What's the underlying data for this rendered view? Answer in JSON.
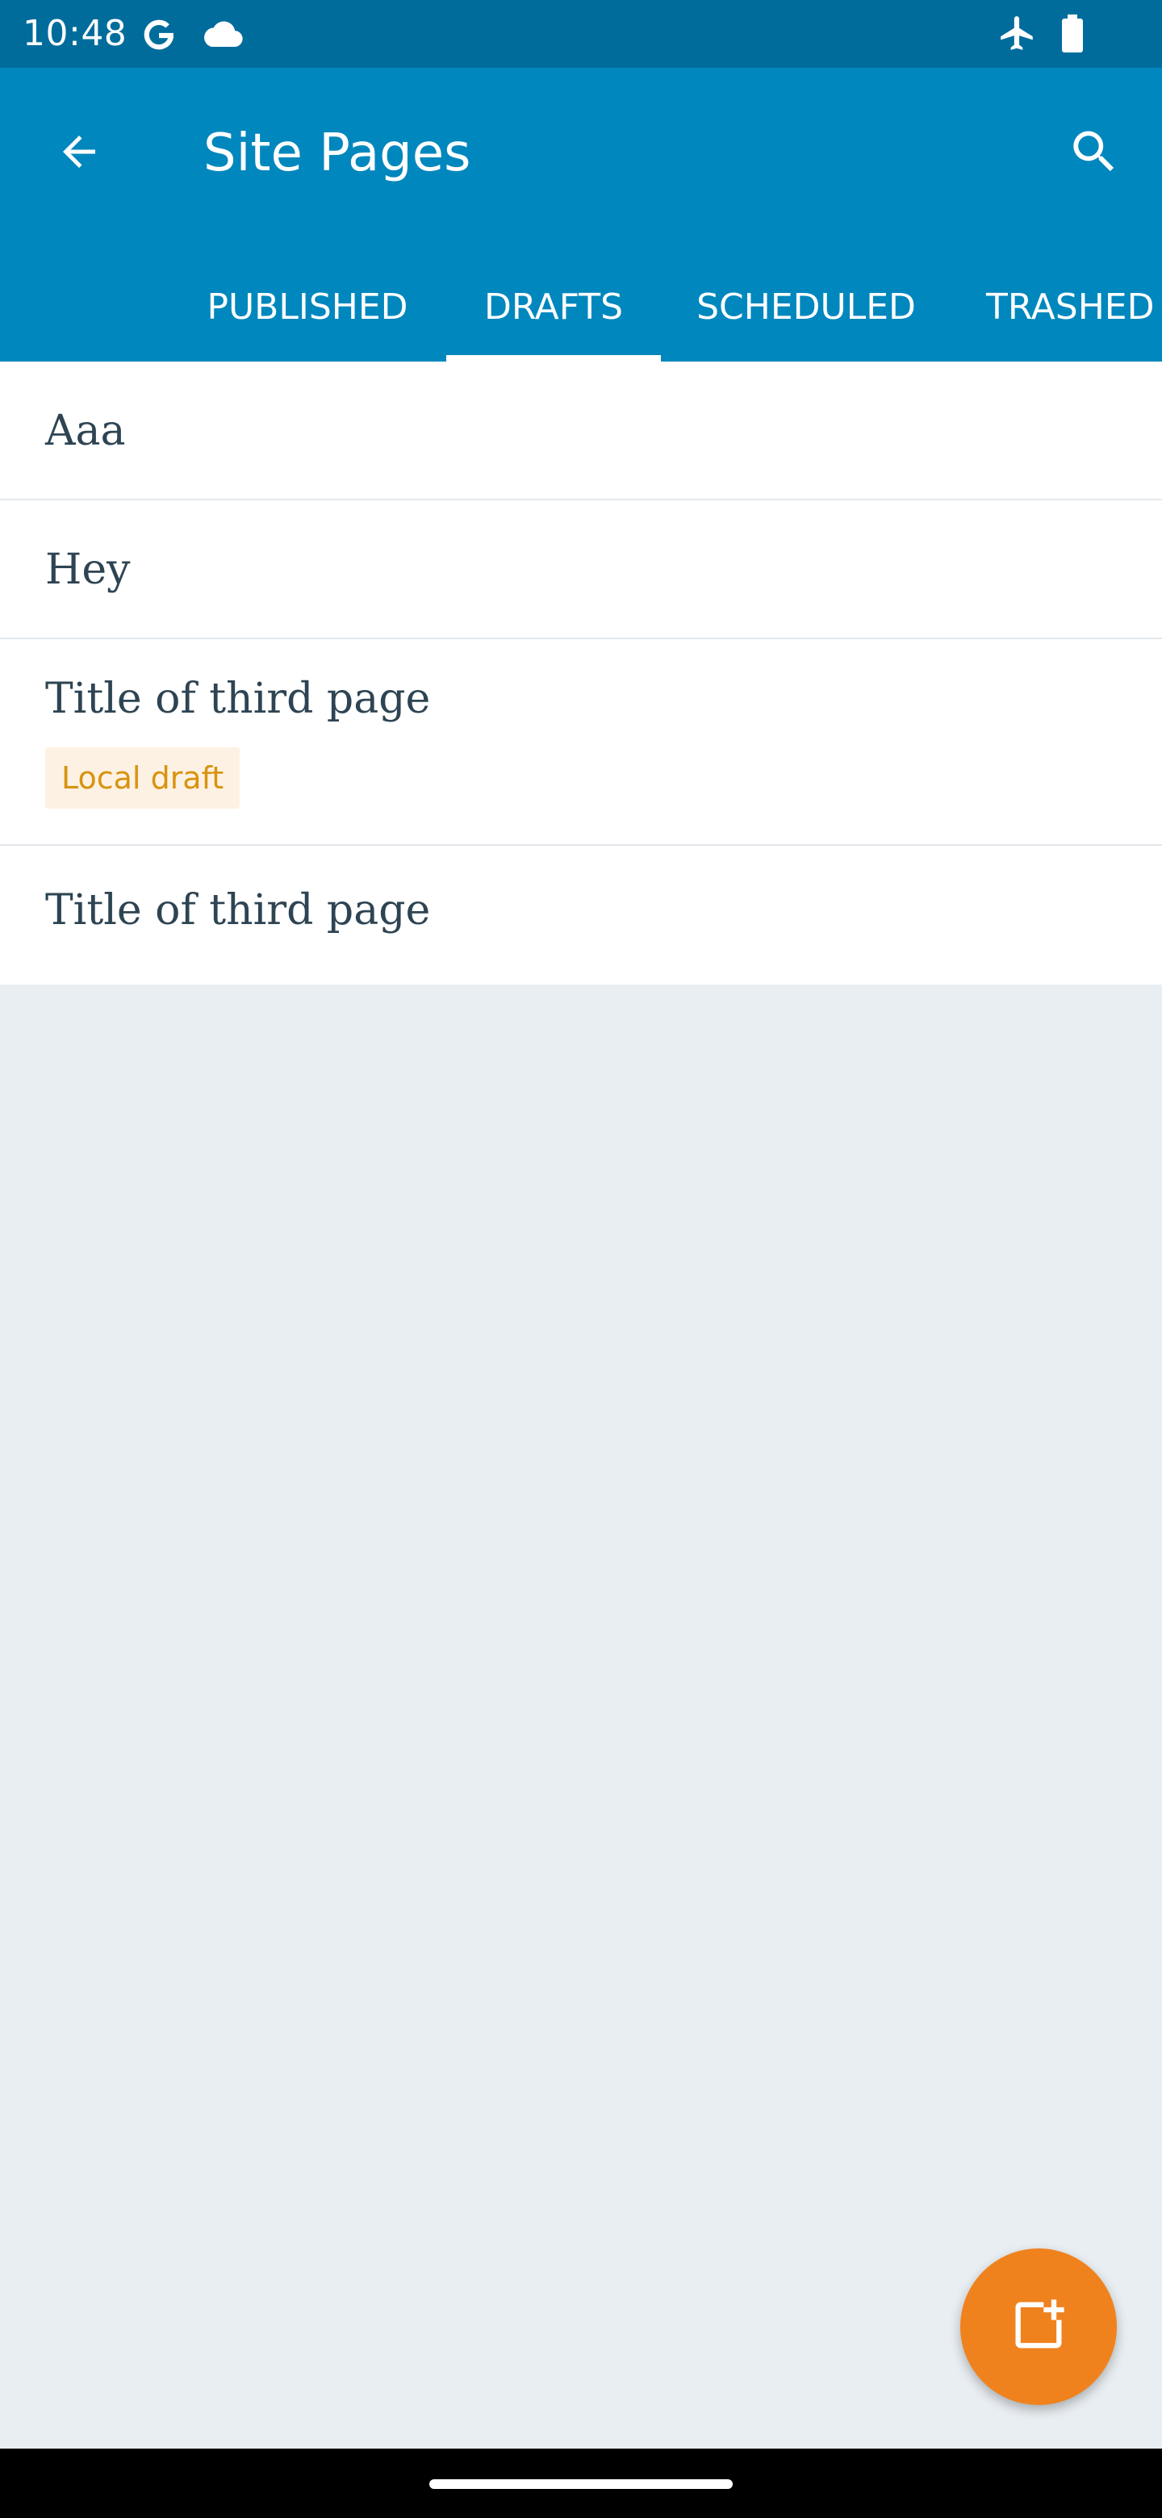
{
  "status_bar": {
    "time": "10:48",
    "left_icons": [
      "google-icon",
      "cloud-icon"
    ],
    "right_icons": [
      "airplane-mode-icon",
      "battery-icon"
    ]
  },
  "app_bar": {
    "title": "Site Pages",
    "back_icon": "arrow-back-icon",
    "search_icon": "search-icon",
    "background_color": "#0087be"
  },
  "tabs": [
    {
      "label": "PUBLISHED",
      "selected": false
    },
    {
      "label": "DRAFTS",
      "selected": true
    },
    {
      "label": "SCHEDULED",
      "selected": false
    },
    {
      "label": "TRASHED",
      "selected": false
    }
  ],
  "pages": [
    {
      "title": "Aaa"
    },
    {
      "title": "Hey"
    },
    {
      "title": "Title of third page",
      "badge": "Local draft"
    },
    {
      "title": "Title of third page"
    }
  ],
  "fab": {
    "icon": "add-page-icon",
    "color": "#f0821e"
  },
  "colors": {
    "status_bar": "#006c9c",
    "list_background": "#e9eef2",
    "badge_text": "#d8930f",
    "badge_background": "#fdf1e3"
  }
}
